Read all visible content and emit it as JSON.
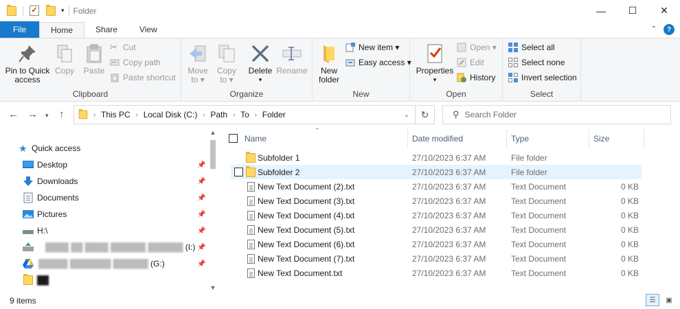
{
  "window": {
    "title": "Folder",
    "controls": [
      "—",
      "☐",
      "✕"
    ]
  },
  "tabs": {
    "file": "File",
    "home": "Home",
    "share": "Share",
    "view": "View"
  },
  "ribbon": {
    "clipboard": {
      "label": "Clipboard",
      "pin": [
        "Pin to Quick",
        "access"
      ],
      "copy": "Copy",
      "paste": "Paste",
      "cut": "Cut",
      "copy_path": "Copy path",
      "paste_shortcut": "Paste shortcut"
    },
    "organize": {
      "label": "Organize",
      "move_to": [
        "Move",
        "to ▾"
      ],
      "copy_to": [
        "Copy",
        "to ▾"
      ],
      "delete": [
        "Delete",
        "▾"
      ],
      "rename": "Rename"
    },
    "new": {
      "label": "New",
      "new_folder": [
        "New",
        "folder"
      ],
      "new_item": "New item ▾",
      "easy_access": "Easy access ▾"
    },
    "open": {
      "label": "Open",
      "properties": [
        "Properties",
        "▾"
      ],
      "open": "Open ▾",
      "edit": "Edit",
      "history": "History"
    },
    "select": {
      "label": "Select",
      "select_all": "Select all",
      "select_none": "Select none",
      "invert": "Invert selection"
    }
  },
  "address": {
    "crumbs": [
      "This PC",
      "Local Disk (C:)",
      "Path",
      "To",
      "Folder"
    ],
    "search_placeholder": "Search Folder"
  },
  "nav": {
    "quick_access": "Quick access",
    "items": [
      {
        "label": "Desktop",
        "icon": "desktop-icon"
      },
      {
        "label": "Downloads",
        "icon": "downloads-icon"
      },
      {
        "label": "Documents",
        "icon": "documents-icon"
      },
      {
        "label": "Pictures",
        "icon": "pictures-icon"
      },
      {
        "label": "H:\\",
        "icon": "drive-icon"
      },
      {
        "label": "(I:)",
        "icon": "google-drive-icon"
      },
      {
        "label": "(G:)",
        "icon": "google-drive-icon"
      }
    ]
  },
  "columns": {
    "name": "Name",
    "date": "Date modified",
    "type": "Type",
    "size": "Size"
  },
  "files": [
    {
      "name": "Subfolder 1",
      "date": "27/10/2023 6:37 AM",
      "type": "File folder",
      "size": "",
      "kind": "folder"
    },
    {
      "name": "Subfolder 2",
      "date": "27/10/2023 6:37 AM",
      "type": "File folder",
      "size": "",
      "kind": "folder"
    },
    {
      "name": "New Text Document (2).txt",
      "date": "27/10/2023 6:37 AM",
      "type": "Text Document",
      "size": "0 KB",
      "kind": "text"
    },
    {
      "name": "New Text Document (3).txt",
      "date": "27/10/2023 6:37 AM",
      "type": "Text Document",
      "size": "0 KB",
      "kind": "text"
    },
    {
      "name": "New Text Document (4).txt",
      "date": "27/10/2023 6:37 AM",
      "type": "Text Document",
      "size": "0 KB",
      "kind": "text"
    },
    {
      "name": "New Text Document (5).txt",
      "date": "27/10/2023 6:37 AM",
      "type": "Text Document",
      "size": "0 KB",
      "kind": "text"
    },
    {
      "name": "New Text Document (6).txt",
      "date": "27/10/2023 6:37 AM",
      "type": "Text Document",
      "size": "0 KB",
      "kind": "text"
    },
    {
      "name": "New Text Document (7).txt",
      "date": "27/10/2023 6:37 AM",
      "type": "Text Document",
      "size": "0 KB",
      "kind": "text"
    },
    {
      "name": "New Text Document.txt",
      "date": "27/10/2023 6:37 AM",
      "type": "Text Document",
      "size": "0 KB",
      "kind": "text"
    }
  ],
  "status": {
    "count": "9 items"
  },
  "colors": {
    "accent": "#1979ca",
    "hover": "#e5f3ff",
    "folder": "#ffd75e"
  }
}
